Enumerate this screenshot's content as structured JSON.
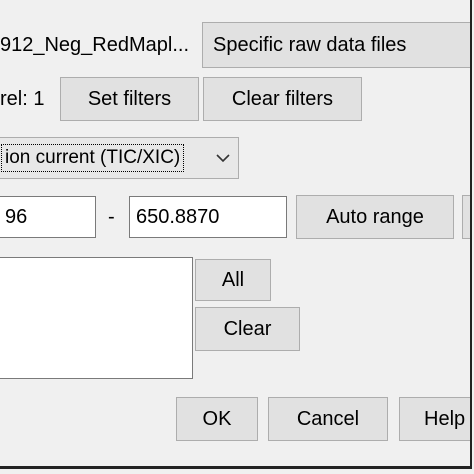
{
  "raw_data": {
    "file_selection": "912_Neg_RedMapl...",
    "source_combo": "Specific raw data files"
  },
  "filters": {
    "level_label": "rel: 1",
    "set_filters_label": "Set filters",
    "clear_filters_label": "Clear filters"
  },
  "plot_type": {
    "selected": "ion current (TIC/XIC)"
  },
  "mz_range": {
    "min_value": "96",
    "separator": "-",
    "max_value": "650.8870",
    "auto_range_label": "Auto range"
  },
  "selection": {
    "all_label": "All",
    "clear_label": "Clear"
  },
  "dialog": {
    "ok_label": "OK",
    "cancel_label": "Cancel",
    "help_label": "Help"
  }
}
